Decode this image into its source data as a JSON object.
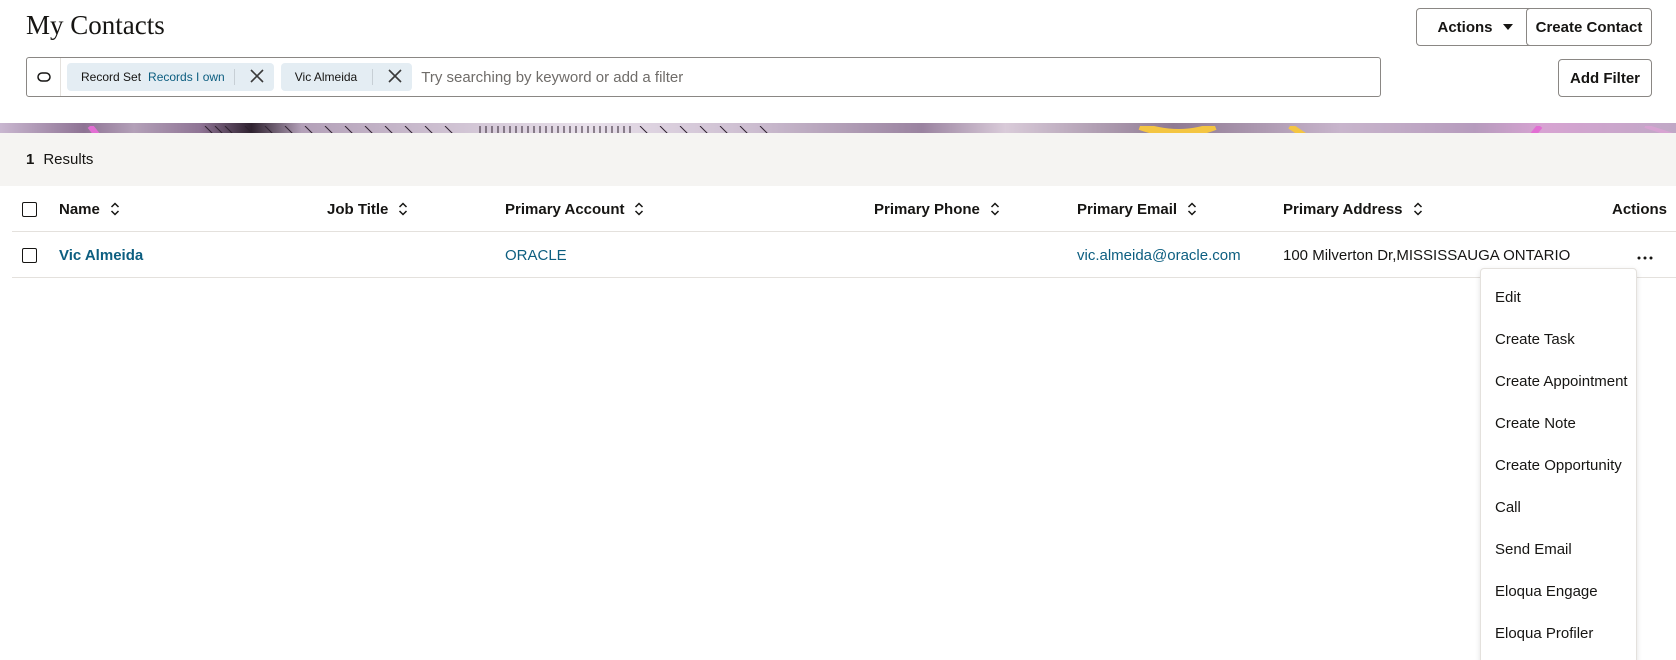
{
  "header": {
    "title": "My Contacts",
    "actions_label": "Actions",
    "create_contact_label": "Create Contact"
  },
  "filter_bar": {
    "search_icon": "search-icon",
    "chips": [
      {
        "label": "Record Set",
        "value": "Records I own"
      },
      {
        "label": "Vic Almeida"
      }
    ],
    "placeholder": "Try searching by keyword or add a filter",
    "add_filter_label": "Add Filter"
  },
  "results": {
    "count": "1",
    "label": "Results"
  },
  "table": {
    "columns": [
      "Name",
      "Job Title",
      "Primary Account",
      "Primary Phone",
      "Primary Email",
      "Primary Address",
      "Actions"
    ],
    "rows": [
      {
        "name": "Vic Almeida",
        "job_title": "",
        "primary_account": "ORACLE",
        "primary_phone": "",
        "primary_email": "vic.almeida@oracle.com",
        "primary_address": "100 Milverton Dr,MISSISSAUGA ONTARIO …",
        "actions_icon": "more-icon"
      }
    ]
  },
  "row_menu": {
    "items": [
      "Edit",
      "Create Task",
      "Create Appointment",
      "Create Note",
      "Create Opportunity",
      "Call",
      "Send Email",
      "Eloqua Engage",
      "Eloqua Profiler"
    ]
  },
  "colors": {
    "link": "#0c5e80",
    "chip_bg": "#e4edf3",
    "results_bg": "#f5f4f2",
    "text": "#161513"
  }
}
